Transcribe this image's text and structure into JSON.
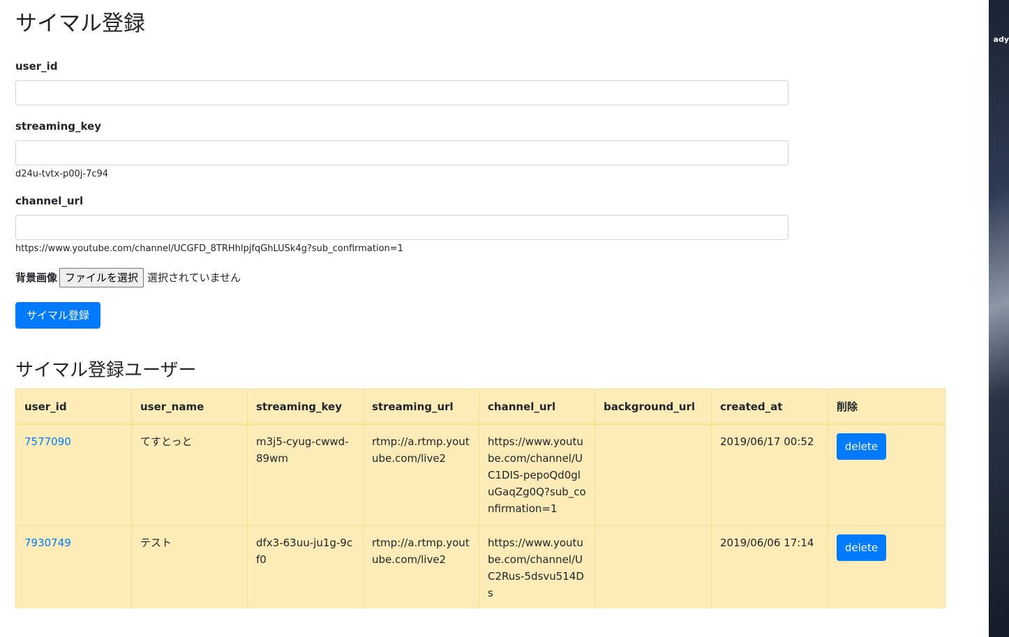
{
  "page": {
    "title": "サイマル登録",
    "side_text": "ady"
  },
  "form": {
    "user_id": {
      "label": "user_id",
      "value": "",
      "placeholder": ""
    },
    "streaming_key": {
      "label": "streaming_key",
      "value": "",
      "placeholder": "",
      "help": "d24u-tvtx-p00j-7c94"
    },
    "channel_url": {
      "label": "channel_url",
      "value": "",
      "placeholder": "",
      "help": "https://www.youtube.com/channel/UCGFD_8TRHhlpjfqGhLUSk4g?sub_confirmation=1"
    },
    "background": {
      "label": "背景画像",
      "button": "ファイルを選択",
      "status": "選択されていません"
    },
    "submit_label": "サイマル登録"
  },
  "users": {
    "title": "サイマル登録ユーザー",
    "columns": [
      "user_id",
      "user_name",
      "streaming_key",
      "streaming_url",
      "channel_url",
      "background_url",
      "created_at",
      "削除"
    ],
    "rows": [
      {
        "user_id": "7577090",
        "user_name": "てすとっと",
        "streaming_key": "m3j5-cyug-cwwd-89wm",
        "streaming_url": "rtmp://a.rtmp.youtube.com/live2",
        "channel_url": "https://www.youtube.com/channel/UC1DIS-pepoQd0gluGaqZg0Q?sub_confirmation=1",
        "background_url": "",
        "created_at": "2019/06/17 00:52",
        "delete_label": "delete"
      },
      {
        "user_id": "7930749",
        "user_name": "テスト",
        "streaming_key": "dfx3-63uu-ju1g-9cf0",
        "streaming_url": "rtmp://a.rtmp.youtube.com/live2",
        "channel_url": "https://www.youtube.com/channel/UC2Rus-5dsvu514Ds",
        "background_url": "",
        "created_at": "2019/06/06 17:14",
        "delete_label": "delete"
      }
    ]
  },
  "colors": {
    "primary": "#007bff",
    "table_background": "#fdecb7",
    "table_border": "#fbdd8a"
  }
}
